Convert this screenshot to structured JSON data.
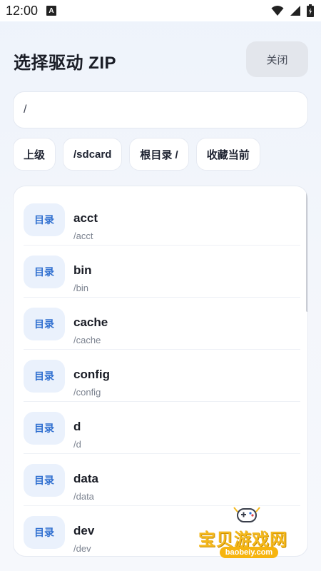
{
  "status_bar": {
    "time": "12:00",
    "notification_letter": "A"
  },
  "header": {
    "title": "选择驱动 ZIP",
    "close_label": "关闭"
  },
  "path_field": {
    "value": "/"
  },
  "chips": [
    {
      "label": "上级"
    },
    {
      "label": "/sdcard"
    },
    {
      "label": "根目录 /"
    },
    {
      "label": "收藏当前"
    }
  ],
  "list": {
    "items": [
      {
        "badge": "目录",
        "name": "acct",
        "path": "/acct"
      },
      {
        "badge": "目录",
        "name": "bin",
        "path": "/bin"
      },
      {
        "badge": "目录",
        "name": "cache",
        "path": "/cache"
      },
      {
        "badge": "目录",
        "name": "config",
        "path": "/config"
      },
      {
        "badge": "目录",
        "name": "d",
        "path": "/d"
      },
      {
        "badge": "目录",
        "name": "data",
        "path": "/data"
      },
      {
        "badge": "目录",
        "name": "dev",
        "path": "/dev"
      }
    ]
  },
  "watermark": {
    "name": "宝贝游戏网",
    "url": "baobeiy.com"
  },
  "colors": {
    "accent": "#2f6fd0",
    "badge_bg": "#eaf1fc",
    "close_bg": "#e3e6ec",
    "watermark": "#f4b91e"
  }
}
